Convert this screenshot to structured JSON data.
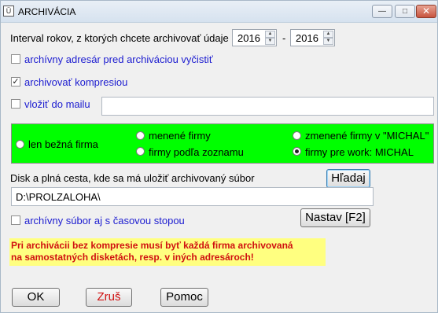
{
  "window": {
    "title": "ARCHIVÁCIA",
    "icon_glyph": "Ü"
  },
  "interval": {
    "label": "Interval rokov, z ktorých chcete archivovať údaje",
    "from": "2016",
    "separator": "-",
    "to": "2016"
  },
  "options": {
    "clear_dir": {
      "label": "archívny adresár pred archiváciou vyčistiť",
      "checked": false
    },
    "compress": {
      "label": "archivovať kompresiou",
      "checked": true
    },
    "email": {
      "label": "vložiť do mailu",
      "checked": false,
      "value": ""
    }
  },
  "firms": {
    "only_current": "len bežná firma",
    "changed": "menené firmy",
    "changed_in": "zmenené firmy v \"MICHAL\"",
    "by_list": "firmy podľa zoznamu",
    "for_work": "firmy pre work: MICHAL",
    "selected": "for_work"
  },
  "path": {
    "label": "Disk a plná cesta, kde sa má uložiť archivovaný súbor",
    "search_button": "Hľadaj",
    "value": "D:\\PROLZALOHA\\"
  },
  "timestamp": {
    "label": "archívny súbor aj s časovou stopou",
    "checked": false
  },
  "settings_button": "Nastav [F2]",
  "warning": {
    "line1": "Pri archivácii bez kompresie musí byť každá firma archivovaná",
    "line2": "na samostatných disketách, resp. v iných adresároch!"
  },
  "buttons": {
    "ok": "OK",
    "cancel": "Zruš",
    "help": "Pomoc"
  },
  "colors": {
    "green_panel": "#00ff00",
    "warning_bg": "#ffff80",
    "warning_text": "#d01010",
    "link_blue": "#1c1cd0"
  },
  "icons": {
    "minimize": "minimize-icon",
    "maximize": "maximize-icon",
    "close": "close-icon",
    "spin_up": "chevron-up-icon",
    "spin_down": "chevron-down-icon"
  }
}
